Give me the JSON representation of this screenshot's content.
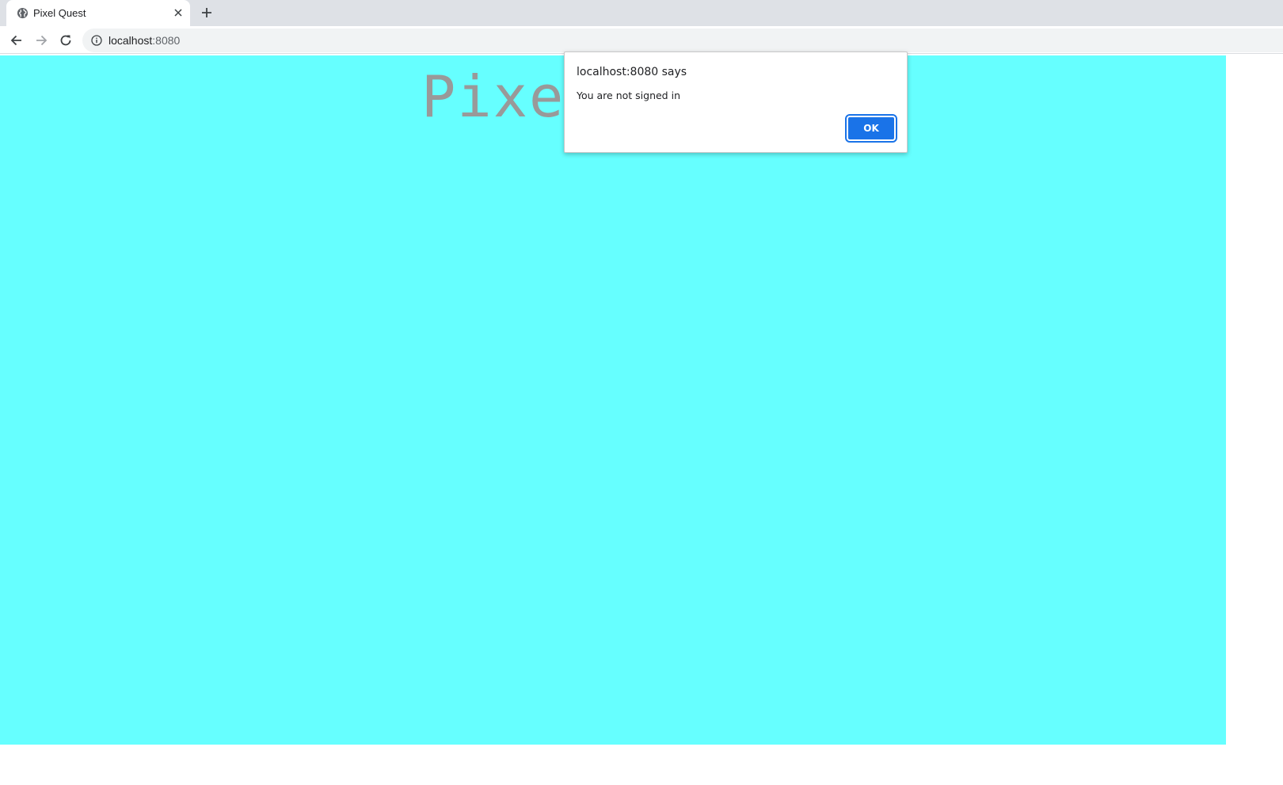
{
  "browser": {
    "tab": {
      "title": "Pixel Quest",
      "favicon": "globe-icon"
    },
    "new_tab_icon": "plus-icon",
    "address_bar": {
      "host": "localhost",
      "port": ":8080",
      "security_icon": "info-icon"
    },
    "nav": {
      "back": "arrow-left-icon",
      "forward": "arrow-right-icon",
      "reload": "reload-icon"
    }
  },
  "page": {
    "title": "Pixe",
    "background_color": "#66ffff",
    "title_color": "#999999"
  },
  "dialog": {
    "heading": "localhost:8080 says",
    "message": "You are not signed in",
    "ok_label": "OK",
    "accent_color": "#1a73e8"
  }
}
